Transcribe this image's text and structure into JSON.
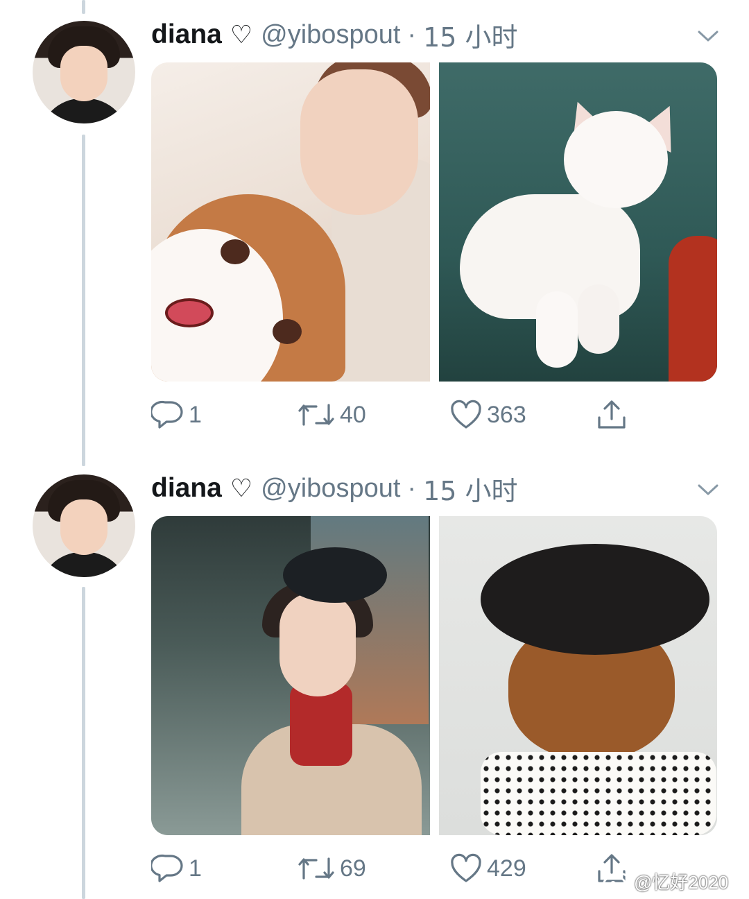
{
  "tweets": [
    {
      "author": {
        "name": "diana",
        "name_badge": "♡",
        "handle": "@yibospout"
      },
      "separator": "·",
      "time": "15 小时",
      "media": [
        "sleeping-person-with-plush",
        "sleeping-white-cat"
      ],
      "actions": {
        "replies": "1",
        "retweets": "40",
        "likes": "363"
      }
    },
    {
      "author": {
        "name": "diana",
        "name_badge": "♡",
        "handle": "@yibospout"
      },
      "separator": "·",
      "time": "15 小时",
      "media": [
        "person-in-beret",
        "cat-in-beret"
      ],
      "actions": {
        "replies": "1",
        "retweets": "69",
        "likes": "429"
      }
    }
  ],
  "watermark": {
    "text": "@忆好2020"
  },
  "colors": {
    "text_primary": "#14171a",
    "text_secondary": "#657786",
    "thread_line": "#ccd6dd"
  }
}
